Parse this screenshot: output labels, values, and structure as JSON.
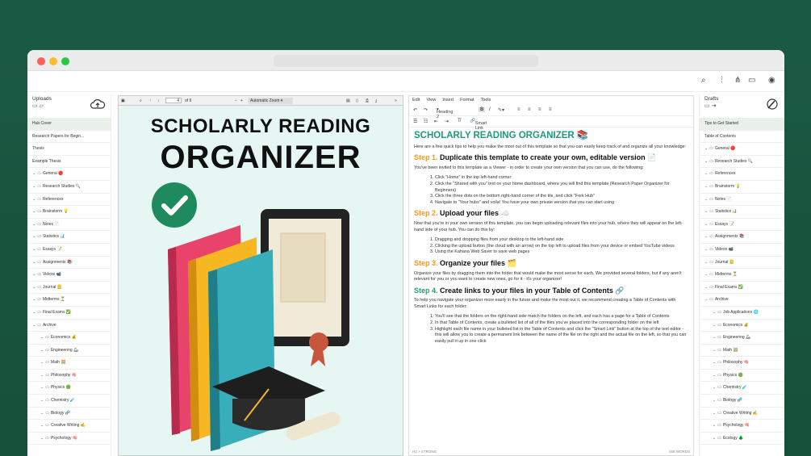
{
  "colors": {
    "background": "#1a5a45",
    "accent": "#1f9a7a",
    "step_orange": "#f39a25",
    "step_green": "#2aa168"
  },
  "window": {
    "dots": [
      "#fe5f57",
      "#febc2e",
      "#28c840"
    ]
  },
  "topbar": {
    "icons": [
      "search-icon",
      "sliders-icon",
      "share-icon",
      "comment-icon",
      "user-icon"
    ]
  },
  "left": {
    "title": "Uploads",
    "items": [
      {
        "label": "Hub Cover",
        "type": "page",
        "selected": true
      },
      {
        "label": "Research Papers for Begin...",
        "type": "page"
      },
      {
        "label": "Thesis",
        "type": "page"
      },
      {
        "label": "Example Thesis",
        "type": "page"
      },
      {
        "label": "General 🔴",
        "type": "folder"
      },
      {
        "label": "Research Studies 🔍",
        "type": "folder"
      },
      {
        "label": "References",
        "type": "folder"
      },
      {
        "label": "Brainstorm 💡",
        "type": "folder"
      },
      {
        "label": "Notes 📄",
        "type": "folder"
      },
      {
        "label": "Statistics 📊",
        "type": "folder"
      },
      {
        "label": "Essays 📝",
        "type": "folder"
      },
      {
        "label": "Assignments 📚",
        "type": "folder"
      },
      {
        "label": "Videos 📹",
        "type": "folder"
      },
      {
        "label": "Journal 📒",
        "type": "folder"
      },
      {
        "label": "Midterms ⏳",
        "type": "folder"
      },
      {
        "label": "Final Exams ✅",
        "type": "folder"
      },
      {
        "label": "Archive",
        "type": "folder"
      },
      {
        "label": "Economics 💰",
        "type": "sub"
      },
      {
        "label": "Engineering 🦾",
        "type": "sub"
      },
      {
        "label": "Math 🧮",
        "type": "sub"
      },
      {
        "label": "Philosophy 🧠",
        "type": "sub"
      },
      {
        "label": "Physics 🟢",
        "type": "sub"
      },
      {
        "label": "Chemistry 🧪",
        "type": "sub"
      },
      {
        "label": "Biology 🧬",
        "type": "sub"
      },
      {
        "label": "Creative Writing ✍️",
        "type": "sub"
      },
      {
        "label": "Psychology 🧠",
        "type": "sub"
      }
    ]
  },
  "right": {
    "title": "Drafts",
    "items": [
      {
        "label": "Tips to Get Started",
        "type": "page",
        "selected": true
      },
      {
        "label": "Table of Contents",
        "type": "page"
      },
      {
        "label": "General 🔴",
        "type": "folder"
      },
      {
        "label": "Research Studies 🔍",
        "type": "folder"
      },
      {
        "label": "References",
        "type": "folder"
      },
      {
        "label": "Brainstorm 💡",
        "type": "folder"
      },
      {
        "label": "Notes 📄",
        "type": "folder"
      },
      {
        "label": "Statistics 📊",
        "type": "folder"
      },
      {
        "label": "Essays 📝",
        "type": "folder"
      },
      {
        "label": "Assignments 📚",
        "type": "folder"
      },
      {
        "label": "Videos 📹",
        "type": "folder"
      },
      {
        "label": "Journal 📒",
        "type": "folder"
      },
      {
        "label": "Midterms ⏳",
        "type": "folder"
      },
      {
        "label": "Final Exams ✅",
        "type": "folder"
      },
      {
        "label": "Archive",
        "type": "folder"
      },
      {
        "label": "Job Applications 🌐",
        "type": "sub"
      },
      {
        "label": "Economics 💰",
        "type": "sub"
      },
      {
        "label": "Engineering 🦾",
        "type": "sub"
      },
      {
        "label": "Math 🧮",
        "type": "sub"
      },
      {
        "label": "Philosophy 🧠",
        "type": "sub"
      },
      {
        "label": "Physics 🟢",
        "type": "sub"
      },
      {
        "label": "Chemistry 🧪",
        "type": "sub"
      },
      {
        "label": "Biology 🧬",
        "type": "sub"
      },
      {
        "label": "Creative Writing ✍️",
        "type": "sub"
      },
      {
        "label": "Psychology 🧠",
        "type": "sub"
      },
      {
        "label": "Ecology 🌲",
        "type": "sub"
      }
    ]
  },
  "pdf": {
    "page": "4",
    "of": "of 9",
    "zoom": "Automatic Zoom",
    "title1": "SCHOLARLY READING",
    "title2": "ORGANIZER"
  },
  "editor": {
    "menu": [
      "Edit",
      "View",
      "Insert",
      "Format",
      "Tools"
    ],
    "heading": "Heading 2",
    "smart_link": "Smart Link",
    "h1": "SCHOLARLY READING ORGANIZER 📚",
    "intro": "Here are a few quick tips to help you make the most out of this template so that you can easily keep track of and organize all your knowledge:",
    "s1": {
      "num": "Step 1.",
      "title": " Duplicate this template to create your own, editable version 📄"
    },
    "s1p": "You've been invited to this template as a Viewer - in order to create your own version that you can use, do the following:",
    "s1list": [
      "Click \"Home\" in the top left-hand corner",
      "Click the \"Shared with you\" text on your home dashboard, where you will find this template (Research Paper Organizer for Beginners)",
      "Click the three dots on the bottom right-hand corner of the tile, and click \"Fork Hub\"",
      "Navigate to \"Your hubs\" and voila! You have your own private version that you can start using"
    ],
    "s2": {
      "num": "Step 2.",
      "title": " Upload your files ☁️"
    },
    "s2p": "Now that you're in your own version of this template, you can begin uploading relevant files into your hub, where they will appear on the left-hand side of your hub. You can do this by:",
    "s2list": [
      "Dragging and dropping files from your desktop to the left-hand side",
      "Clicking the upload button (the cloud with an arrow) on the top left to upload files from your device or embed YouTube videos",
      "Using the Kahana Web Saver to save web pages"
    ],
    "s3": {
      "num": "Step 3.",
      "title": " Organize your files 🗂️"
    },
    "s3p": "Organize your files by dragging them into the folder that would make the most sense for each. We provided several folders, but if any aren't relevant for you or you want to create new ones, go for it - it's your organizer!",
    "s4": {
      "num": "Step 4.",
      "title": " Create links to your files in your Table of Contents 🔗"
    },
    "s4p": "To help you navigate your organizer more easily in the future and make the most out it, we recommend creating a Table of Contents with Smart Links for each folder:",
    "s4list": [
      "You'll see that the folders on the right-hand side match the folders on the left, and each has a page for a Table of Contents",
      "In that Table of Contents, create a bulleted list of all of the files you've placed into the corresponding folder on the left",
      "Highlight each file name in your bulleted list in the Table of Contents and click the \"Smart Link\" button at the top of the text editor - this will allow you to create a permanent link between the name of the file on the right and the actual file on the left, so that you can easily pull it up in one click"
    ],
    "footer_left": "H2 > STRONG",
    "footer_right": "468 WORDS"
  }
}
